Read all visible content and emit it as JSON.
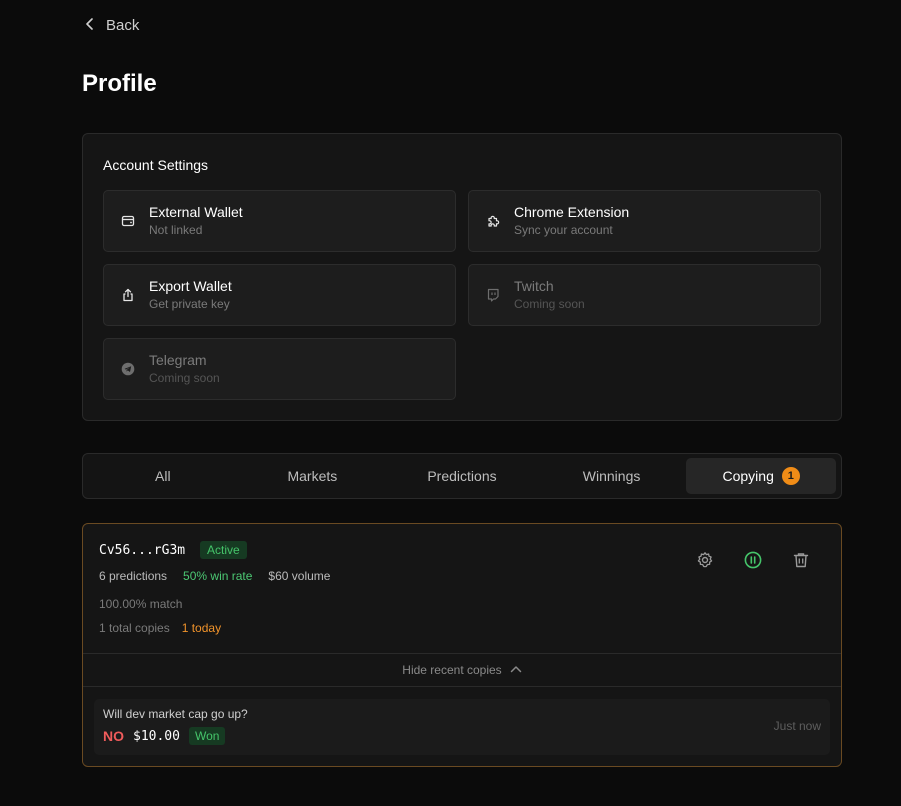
{
  "nav": {
    "back_label": "Back"
  },
  "page": {
    "title": "Profile"
  },
  "settings": {
    "title": "Account Settings",
    "tiles": [
      {
        "label": "External Wallet",
        "sub": "Not linked",
        "icon": "wallet-icon"
      },
      {
        "label": "Chrome Extension",
        "sub": "Sync your account",
        "icon": "puzzle-icon"
      },
      {
        "label": "Export Wallet",
        "sub": "Get private key",
        "icon": "export-icon"
      },
      {
        "label": "Twitch",
        "sub": "Coming soon",
        "icon": "twitch-icon"
      },
      {
        "label": "Telegram",
        "sub": "Coming soon",
        "icon": "telegram-icon"
      }
    ]
  },
  "tabs": {
    "items": [
      {
        "label": "All"
      },
      {
        "label": "Markets"
      },
      {
        "label": "Predictions"
      },
      {
        "label": "Winnings"
      },
      {
        "label": "Copying",
        "badge": "1"
      }
    ],
    "active": "Copying"
  },
  "copy": {
    "address": "Cv56...rG3m",
    "status": "Active",
    "predictions": "6 predictions",
    "win_rate": "50% win rate",
    "volume": "$60 volume",
    "match": "100.00% match",
    "total_copies": "1 total copies",
    "today": "1 today",
    "toggle_label": "Hide recent copies",
    "recent": [
      {
        "question": "Will dev market cap go up?",
        "side": "NO",
        "amount": "$10.00",
        "result": "Won",
        "time": "Just now"
      }
    ]
  },
  "colors": {
    "accent_orange": "#f08c17",
    "green": "#45c46a",
    "red": "#ef5b5b",
    "background": "#0b0b0b"
  }
}
